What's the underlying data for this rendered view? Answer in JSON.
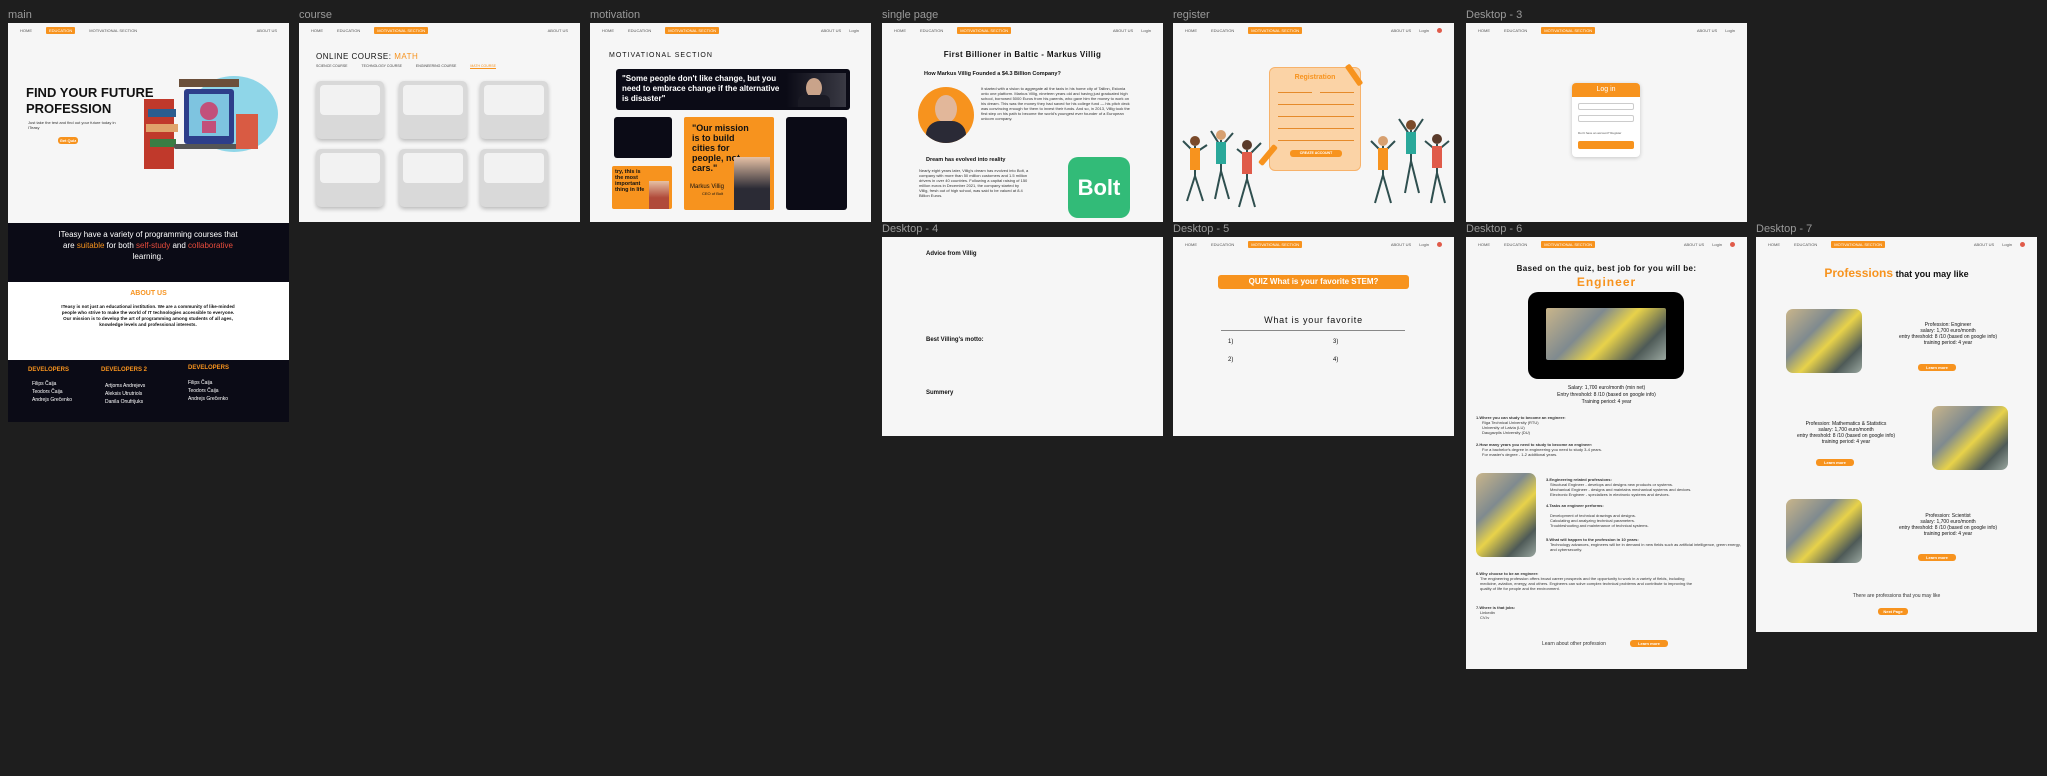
{
  "frame_labels": {
    "main": "main",
    "course": "course",
    "motivation": "motivation",
    "single": "single page",
    "register": "register",
    "d3": "Desktop - 3",
    "d4": "Desktop - 4",
    "d5": "Desktop - 5",
    "d6": "Desktop - 6",
    "d7": "Desktop - 7"
  },
  "nav": {
    "home": "HOME",
    "education": "EDUCATION",
    "motivation": "MOTIVATIONAL SECTION",
    "about": "ABOUT US",
    "login": "Login"
  },
  "main": {
    "hero_title": "FIND YOUR FUTURE PROFESSION",
    "hero_sub": "Just take the test and find out your future today in ITeasy",
    "hero_btn": "Get Quiz",
    "dark_p1": "ITeasy have a variety of programming courses that are ",
    "dark_w1": "suitable",
    "dark_p2": " for both ",
    "dark_w2": "self-study",
    "dark_p3": " and ",
    "dark_w3": "collaborative",
    "dark_p4": " learning.",
    "about_title": "ABOUT US",
    "about_text": "ITeasy is not just an educational institution. We are a community of like-minded people who strive to make the world of IT technologies accessible to everyone. Our mission is to develop the art of programming among students of all ages, knowledge levels and professional interests.",
    "dev_titles": [
      "DEVELOPERS",
      "DEVELOPERS 2",
      "DEVELOPERS"
    ],
    "devs1": [
      "Filips Čaija",
      "Teodors Čaija",
      "Andrejs Grečenko"
    ],
    "devs2": [
      "Artjoms Andrejevs",
      "Aleksis Utrutriols",
      "Danila Onufrijuks"
    ],
    "devs3": [
      "Filips Čaija",
      "Teodors Čaija",
      "Andrejs Grečenko"
    ]
  },
  "course": {
    "title_a": "ONLINE COURSE: ",
    "title_b": "MATH",
    "tabs": [
      "SCIENCE COURSE",
      "TECHNOLOGY COURSE",
      "ENGINEERING COURSE",
      "MATH COURSE"
    ]
  },
  "motivation": {
    "title": "MOTIVATIONAL SECTION",
    "quote1": "\"Some people don't like change, but you need to embrace change if the alternative is disaster\"",
    "quote2": "\"Our mission is to build cities for people, not cars.\"",
    "quote2_author": "Markus Villig",
    "quote2_role": "CEO of Bolt",
    "quote3": "try, this is the most important thing in life"
  },
  "single": {
    "title": "First Billioner in Baltic - Markus Villig",
    "q1": "How Markus Villig Founded a $4.3 Billion Company?",
    "p1": "It started with a vision to aggregate all the taxis in his home city of Tallinn, Estonia onto one platform. Markus Villig, nineteen years old and having just graduated high school, borrowed 5000 Euros from his parents, who gave him the money to work on his dream. This was the money they had saved for his college fund — his pitch deck was convincing enough for them to invest their funds. And so, in 2013, Villig took the first step on his path to become the world's youngest ever founder of a European unicorn company.",
    "q2": "Dream has evolved into reality",
    "p2": "Nearly eight years later, Villig's dream has evolved into Bolt, a company with more than 50 million customers and 1.5 million drivers in over 40 countries. Following a capital raising of 150 million euros in December 2021, the company started by Villig, fresh out of high school, was said to be valued at 8.4 Billion Euros.",
    "logo": "Bolt"
  },
  "register": {
    "title": "Registration",
    "btn": "CREATE ACCOUNT"
  },
  "d3": {
    "title": "Log in",
    "note": "Don't have an account? Register"
  },
  "d4": {
    "a": "Advice from Villig",
    "b": "Best Villing's motto:",
    "c": "Summery"
  },
  "d5": {
    "banner": "QUIZ What is your favorite STEM?",
    "question": "What is your favorite",
    "opts": [
      "1)",
      "3)",
      "2)",
      "4)"
    ]
  },
  "d6": {
    "title": "Based on the quiz, best job for you will be:",
    "job": "Engineer",
    "salary": "Salary: 1,700 euro/month (min net)",
    "entry": "Entry threshold: 8 /10 (based on google info)",
    "training": "Training period: 4 year",
    "s1": "1.Where you can study to become an engineer:",
    "s1i": [
      "Riga Technical University (RTU)",
      "University of Latvia (LU)",
      "Daugavpils University (DU)"
    ],
    "s2": "2.How many years you need to study to become an engineer:",
    "s2i": [
      "For a bachelor's degree in engineering you need to study 3-4 years.",
      "For master's degree - 1-2 additional years."
    ],
    "s3": "3.Engineering related professions:",
    "s3i": [
      "Structural Engineer - develops and designs new products or systems.",
      "Mechanical Engineer - designs and maintains mechanical systems and devices.",
      "Electronic Engineer - specializes in electronic systems and devices."
    ],
    "s4": "4.Tasks an engineer performs:",
    "s4i": [
      "Development of technical drawings and designs.",
      "Calculating and analyzing technical parameters.",
      "Troubleshooting and maintenance of technical systems."
    ],
    "s5": "5.What will happen to the profession in 10 years:",
    "s5i": [
      "Technology advances, engineers will be in demand in new fields such as artificial intelligence, green energy, and cybersecurity."
    ],
    "s6": "6.Why choose to be an engineer:",
    "s6i": [
      "The engineering profession offers broad career prospects and the opportunity to work in a variety of fields, including medicine, aviation, energy, and others. Engineers can solve complex technical problems and contribute to improving the quality of life for people and the environment."
    ],
    "s7": "7.Where is that jobs:",
    "s7i": [
      "Linkedin",
      "CV.lv"
    ],
    "more": "Learn about other profession",
    "more_btn": "Learn more"
  },
  "d7": {
    "title_a": "Professions",
    "title_b": " that you may like",
    "items": [
      {
        "name": "Profession: Engineer",
        "salary": "salary: 1,700 euro/month",
        "entry": "entry threshold: 8 /10 (based on google info)",
        "training": "training period: 4 year",
        "btn": "Learn more"
      },
      {
        "name": "Profession: Mathematics & Statistics",
        "salary": "salary: 1,700 euro/month",
        "entry": "entry threshold: 8 /10 (based on google info)",
        "training": "training period: 4 year",
        "btn": "Learn more"
      },
      {
        "name": "Profession: Scientist",
        "salary": "salary: 1,700 euro/month",
        "entry": "entry threshold: 8 /10 (based on google info)",
        "training": "training period: 4 year",
        "btn": "Learn more"
      }
    ],
    "footer": "There are professions that you may like",
    "footer_btn": "Next Page"
  },
  "colors": {
    "accent": "#f7931e",
    "dark": "#0b0b16",
    "canvas": "#1e1e1e",
    "bolt": "#32bb78"
  }
}
